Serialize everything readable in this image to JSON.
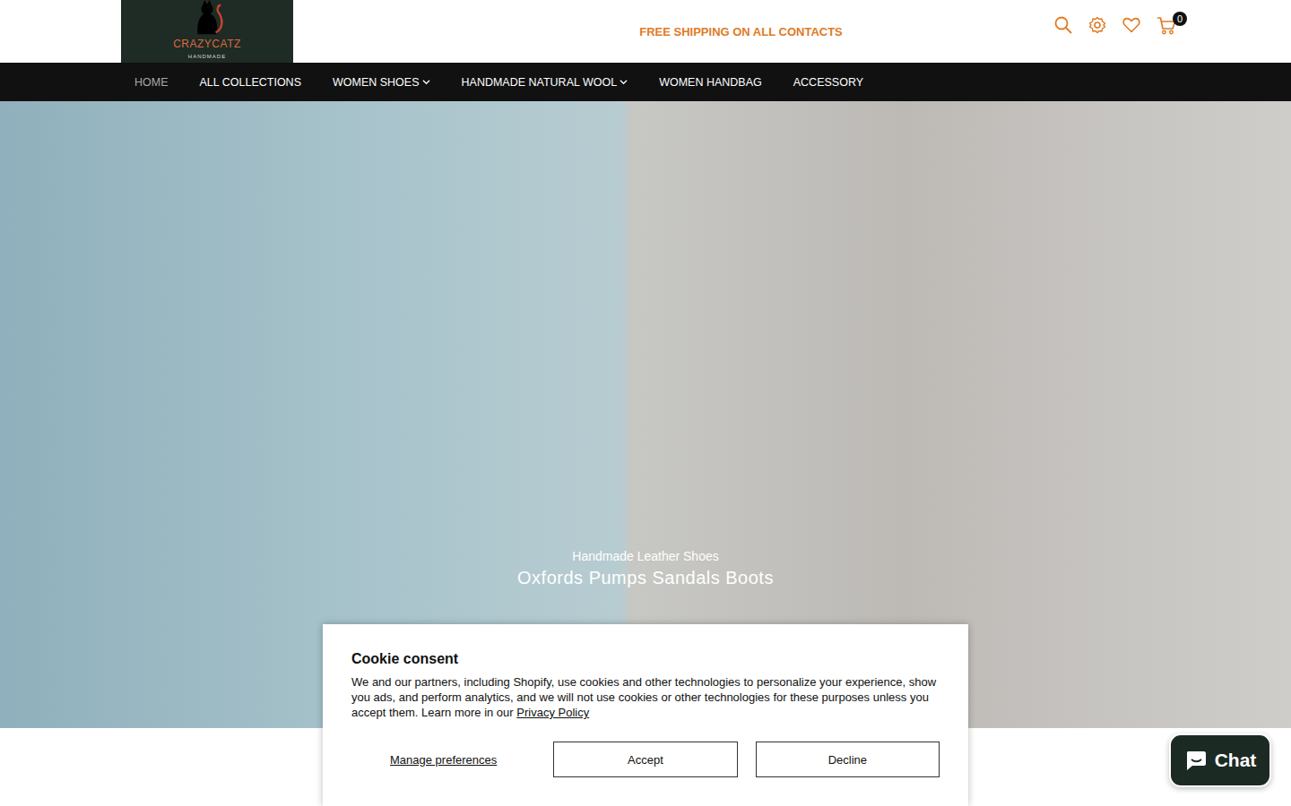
{
  "logo": {
    "title": "CRAZYCATZ",
    "subtitle": "HANDMADE"
  },
  "announcement": "FREE SHIPPING ON ALL CONTACTS",
  "cart": {
    "count": "0"
  },
  "nav": [
    {
      "label": "HOME",
      "selected": true,
      "dropdown": false
    },
    {
      "label": "ALL COLLECTIONS",
      "selected": false,
      "dropdown": false
    },
    {
      "label": "WOMEN SHOES",
      "selected": false,
      "dropdown": true
    },
    {
      "label": "HANDMADE NATURAL WOOL",
      "selected": false,
      "dropdown": true
    },
    {
      "label": "WOMEN HANDBAG",
      "selected": false,
      "dropdown": false
    },
    {
      "label": "ACCESSORY",
      "selected": false,
      "dropdown": false
    }
  ],
  "hero": {
    "subtitle": "Handmade Leather Shoes",
    "title": "Oxfords Pumps Sandals Boots"
  },
  "cookie": {
    "title": "Cookie consent",
    "body": "We and our partners, including Shopify, use cookies and other technologies to personalize your experience, show you ads, and perform analytics, and we will not use cookies or other technologies for these purposes unless you accept them. Learn more in our ",
    "link": "Privacy Policy",
    "buttons": [
      {
        "label": "Manage preferences",
        "kind": "link"
      },
      {
        "label": "Accept",
        "kind": "outline"
      },
      {
        "label": "Decline",
        "kind": "outline"
      }
    ]
  },
  "chat": {
    "label": "Chat"
  }
}
